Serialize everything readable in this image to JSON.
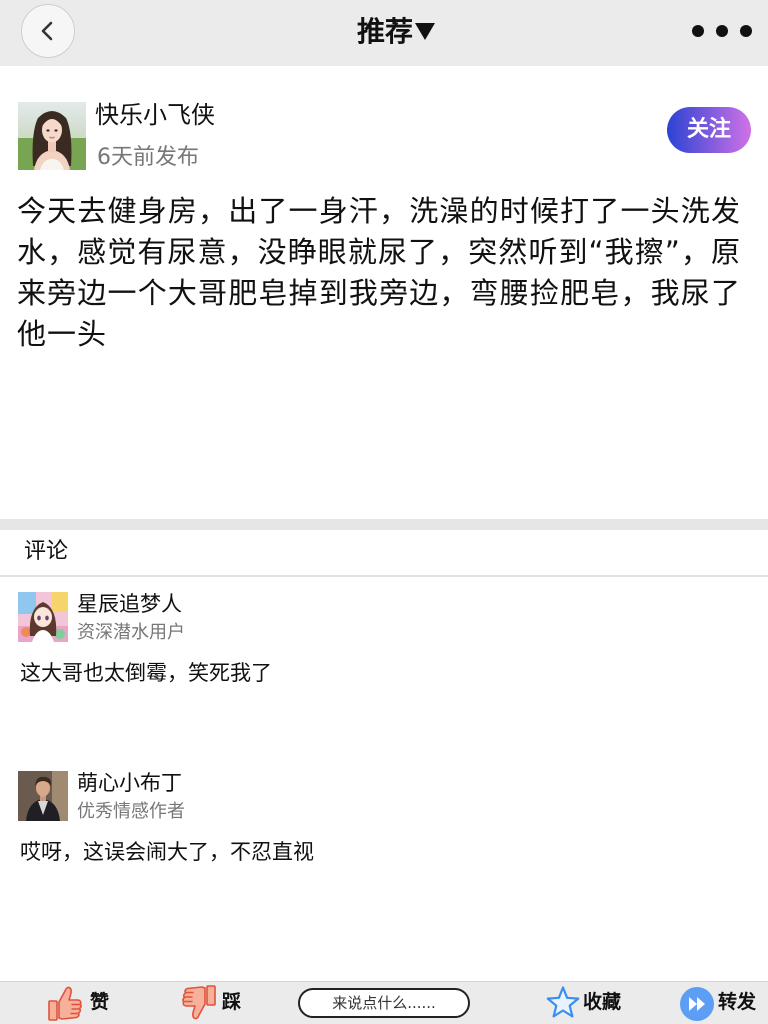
{
  "header": {
    "title": "推荐",
    "dropdown_icon": "caret-down-icon",
    "back_icon": "chevron-left-icon",
    "more_icon": "more-dots-icon"
  },
  "post": {
    "author_name": "快乐小飞侠",
    "time": "6天前发布",
    "follow_label": "关注",
    "content": "今天去健身房，出了一身汗，洗澡的时候打了一头洗发水，感觉有尿意，没睁眼就尿了，突然听到“我擦”，原来旁边一个大哥肥皂掉到我旁边，弯腰捡肥皂，我尿了他一头"
  },
  "comments": {
    "title": "评论",
    "items": [
      {
        "name": "星辰追梦人",
        "badge": "资深潜水用户",
        "text": "这大哥也太倒霉，笑死我了"
      },
      {
        "name": "萌心小布丁",
        "badge": "优秀情感作者",
        "text": "哎呀，这误会闹大了，不忍直视"
      }
    ]
  },
  "bottom_bar": {
    "like_label": "赞",
    "like_icon": "thumbs-up-icon",
    "dislike_label": "踩",
    "dislike_icon": "thumbs-down-icon",
    "comment_placeholder": "来说点什么......",
    "favorite_label": "收藏",
    "favorite_icon": "star-icon",
    "share_label": "转发",
    "share_icon": "forward-icon"
  },
  "colors": {
    "header_bg": "#ebebeb",
    "muted_text": "#777777",
    "follow_gradient_start": "#2b43d4",
    "follow_gradient_end": "#cf72e6",
    "like_fill": "#f7b09a",
    "like_stroke": "#e0523c",
    "icon_blue": "#3b8ef0",
    "share_blue": "#5b9ef3"
  }
}
